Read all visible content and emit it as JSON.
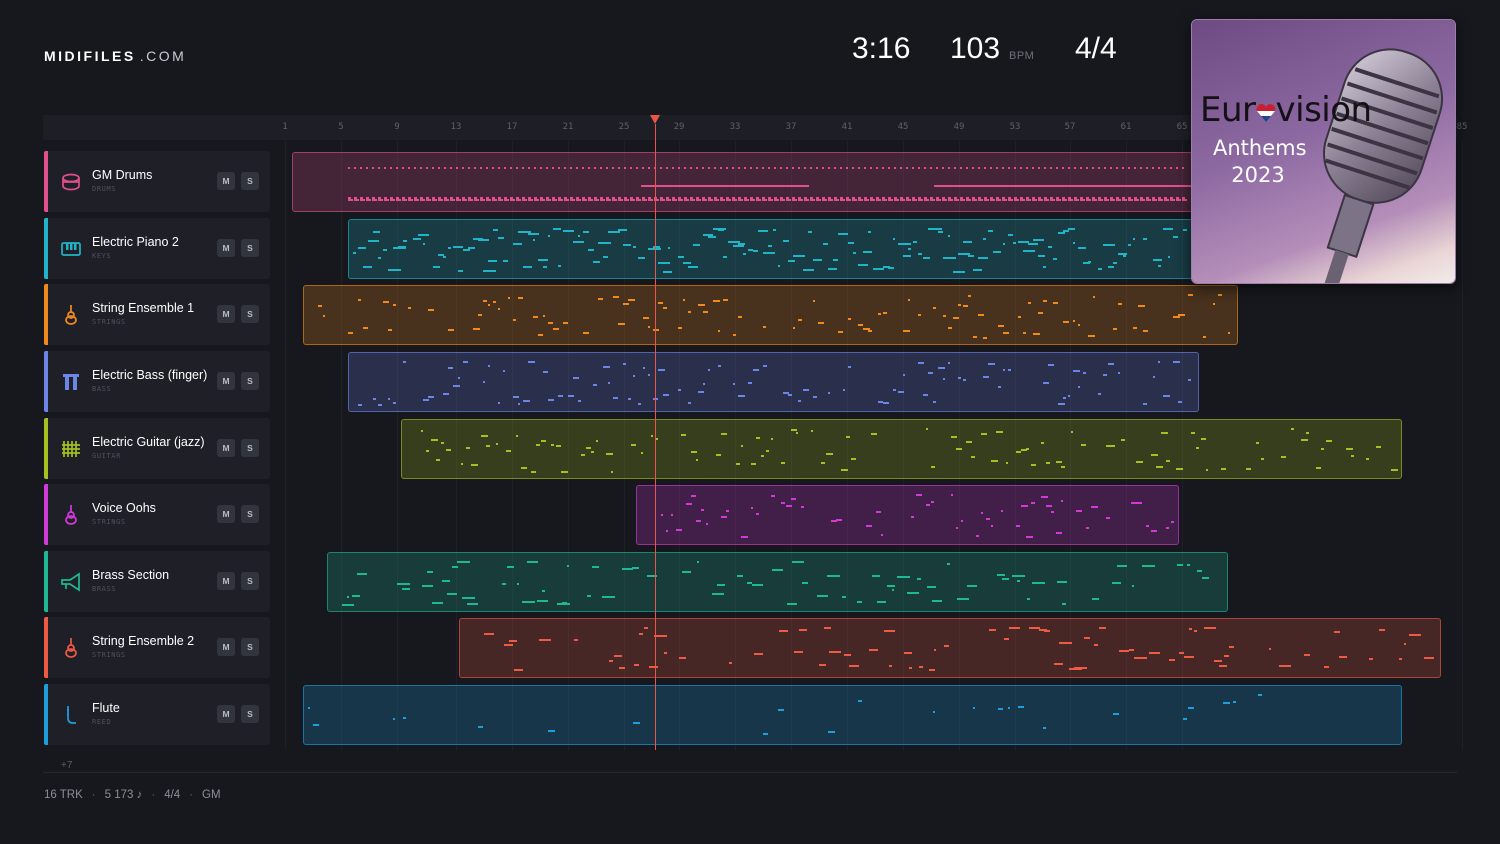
{
  "header": {
    "logo_bold": "MIDIFILES",
    "logo_suffix": ".COM",
    "time": "3:16",
    "bpm": "103",
    "bpm_unit": "BPM",
    "signature": "4/4"
  },
  "ruler": {
    "bars": [
      "1",
      "5",
      "9",
      "13",
      "17",
      "21",
      "25",
      "29",
      "33",
      "37",
      "41",
      "45",
      "49",
      "53",
      "57",
      "61",
      "65",
      "85"
    ]
  },
  "playhead": {
    "bar": 28
  },
  "tracks": [
    {
      "name": "GM Drums",
      "category": "DRUMS",
      "color": "#e0508c",
      "icon": "drum-icon",
      "mute": "M",
      "solo": "S"
    },
    {
      "name": "Electric Piano 2",
      "category": "KEYS",
      "color": "#1fb4c8",
      "icon": "piano-icon",
      "mute": "M",
      "solo": "S"
    },
    {
      "name": "String Ensemble 1",
      "category": "STRINGS",
      "color": "#f08a1c",
      "icon": "violin-icon",
      "mute": "M",
      "solo": "S"
    },
    {
      "name": "Electric Bass (finger)",
      "category": "BASS",
      "color": "#6c86e8",
      "icon": "bass-icon",
      "mute": "M",
      "solo": "S"
    },
    {
      "name": "Electric Guitar (jazz)",
      "category": "GUITAR",
      "color": "#a3c120",
      "icon": "guitar-icon",
      "mute": "M",
      "solo": "S"
    },
    {
      "name": "Voice Oohs",
      "category": "STRINGS",
      "color": "#d23ad8",
      "icon": "violin-icon",
      "mute": "M",
      "solo": "S"
    },
    {
      "name": "Brass Section",
      "category": "BRASS",
      "color": "#1fb896",
      "icon": "trumpet-icon",
      "mute": "M",
      "solo": "S"
    },
    {
      "name": "String Ensemble 2",
      "category": "STRINGS",
      "color": "#ee5a44",
      "icon": "violin-icon",
      "mute": "M",
      "solo": "S"
    },
    {
      "name": "Flute",
      "category": "REED",
      "color": "#1e9edc",
      "icon": "flute-icon",
      "mute": "M",
      "solo": "S"
    }
  ],
  "more_tracks": "+7",
  "footer": {
    "tracks": "16 TRK",
    "notes": "5 173 ♪",
    "signature": "4/4",
    "standard": "GM"
  },
  "cover": {
    "title_left": "Eur",
    "title_right": "vision",
    "subtitle": "Anthems",
    "year": "2023"
  }
}
